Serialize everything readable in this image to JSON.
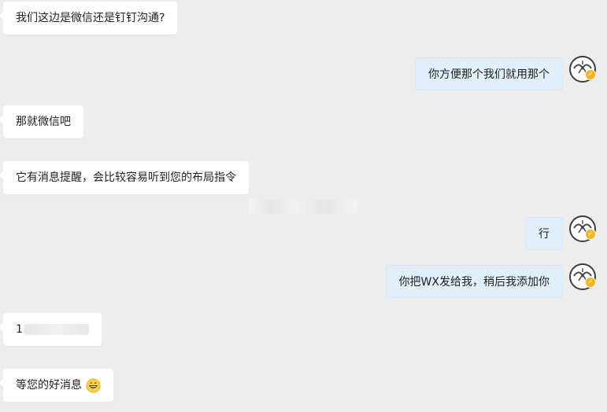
{
  "messages": [
    {
      "side": "incoming",
      "text": "我们这边是微信还是钉钉沟通?"
    },
    {
      "side": "outgoing",
      "text": "你方便那个我们就用那个"
    },
    {
      "side": "incoming",
      "text": "那就微信吧"
    },
    {
      "side": "incoming",
      "text": "它有消息提醒，会比较容易听到您的布局指令"
    },
    {
      "side": "outgoing",
      "text": "行"
    },
    {
      "side": "outgoing",
      "text": "你把WX发给我，稍后我添加你"
    },
    {
      "side": "incoming",
      "text": "1"
    },
    {
      "side": "incoming",
      "text": "等您的好消息"
    }
  ],
  "icons": {
    "avatar": "avatar-icon",
    "verified_badge": "verified-badge-icon",
    "emoji": "grinning-emoji-icon"
  },
  "colors": {
    "background": "#ededed",
    "incoming_bubble": "#ffffff",
    "outgoing_bubble": "#e1effb",
    "badge": "#f5b51f"
  }
}
